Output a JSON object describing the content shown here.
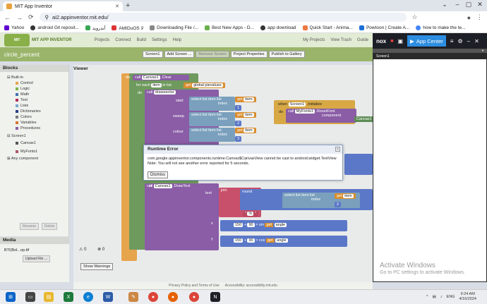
{
  "browser": {
    "tab_title": "MIT App Inventor",
    "url": "ai2.appinventor.mit.edu/",
    "bookmarks": [
      "Yahoo",
      "android Git reposit...",
      "أندرويد",
      "AMIDuOS لا",
      "Downloading File /...",
      "Best New Apps - D...",
      "app download",
      "Quick Start - Anima...",
      "Powtoon | Create A...",
      "how to make the te..."
    ]
  },
  "appinventor": {
    "logo_text": "MIT APP INVENTOR",
    "menus": [
      "Projects",
      "Connect",
      "Build",
      "Settings",
      "Help"
    ],
    "right_menus": [
      "My Projects",
      "View Trash",
      "Guide"
    ],
    "project_name": "circle_percent",
    "project_buttons": [
      "Screen1",
      "Add Screen ...",
      "Remove Screen",
      "Project Properties",
      "Publish to Gallery"
    ],
    "blocks_header": "Blocks",
    "tree": {
      "builtin": "Built-in",
      "builtin_items": [
        "Control",
        "Logic",
        "Math",
        "Text",
        "Lists",
        "Dictionaries",
        "Colors",
        "Variables",
        "Procedures"
      ],
      "screen": "Screen1",
      "components": [
        "Canvas1",
        "MyFonts1"
      ],
      "any": "Any component"
    },
    "rename": "Rename",
    "delete": "Delete",
    "media_header": "Media",
    "media_file": "BTI(Bol...op.ttf",
    "upload": "Upload File ...",
    "viewer_header": "Viewer",
    "warnings": "0",
    "errors": "0",
    "show_warnings": "Show Warnings",
    "footer": [
      "Privacy Policy and Terms of Use",
      "Accessibility: accessibility.mit.edu"
    ]
  },
  "blocks": {
    "do": "do",
    "call": "call",
    "canvas1": "Canvas1",
    "clear": ".Clear",
    "for_each": "for each",
    "item": "item",
    "in_list": "in list",
    "get": "get",
    "global_pievalues": "global pievalues",
    "drawsector": "drawsector",
    "start": "start",
    "sweep": "sweep",
    "colour": "colour",
    "select_list_item": "select list item",
    "list": "list",
    "index": "index",
    "idx1": "1",
    "idx2": "2",
    "idx3": "3",
    "when": "when",
    "screen1": "Screen1",
    "initialize": ".Initialize",
    "myfonts1": "MyFonts1",
    "resetfont": ".ResetFont",
    "component": "component",
    "drawtext": ".DrawText",
    "text": "text",
    "join": "join",
    "round": "round",
    "pct": "%",
    "x": "x",
    "y": "y",
    "n150": "150",
    "n90": "90",
    "sin": "sin",
    "cos": "cos",
    "angle": "angle",
    "in": "in"
  },
  "dialog": {
    "title": "Runtime Error",
    "message": "com.google.appinventor.components.runtime.Canvas$CanvasView cannot be cast to android.widget.TextView",
    "note": "Note: You will not see another error reported for 5 seconds.",
    "dismiss": "Dismiss",
    "close": "×"
  },
  "nox": {
    "logo": "nox",
    "app_center": "App Center",
    "screen_title": "Screen1",
    "activate_title": "Activate Windows",
    "activate_sub": "Go to PC settings to activate Windows."
  },
  "taskbar": {
    "lang": "ENG",
    "time": "9:24 AM",
    "date": "4/16/2024"
  },
  "colors": {
    "ai_green": "#9ab56a",
    "nox_blue": "#2d8de0",
    "block_orange": "#e6a44c"
  }
}
